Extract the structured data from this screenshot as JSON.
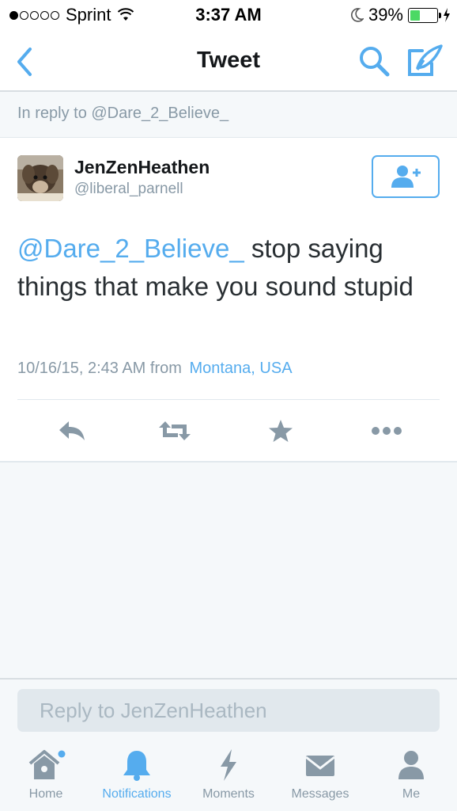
{
  "status_bar": {
    "carrier": "Sprint",
    "time": "3:37 AM",
    "battery": "39%",
    "battery_level": 0.39
  },
  "nav": {
    "title": "Tweet",
    "back_icon": "chevron-left-icon",
    "search_icon": "search-icon",
    "compose_icon": "compose-icon"
  },
  "reply_banner": "In reply to @Dare_2_Believe_",
  "tweet": {
    "display_name": "JenZenHeathen",
    "handle": "@liberal_parnell",
    "mention": "@Dare_2_Believe_",
    "text": " stop saying things that make you sound stupid",
    "timestamp": "10/16/15, 2:43 AM from",
    "location": "Montana, USA"
  },
  "reply": {
    "placeholder": "Reply to JenZenHeathen"
  },
  "tabs": [
    {
      "label": "Home",
      "icon": "home-icon",
      "active": false
    },
    {
      "label": "Notifications",
      "icon": "bell-icon",
      "active": true
    },
    {
      "label": "Moments",
      "icon": "lightning-icon",
      "active": false
    },
    {
      "label": "Messages",
      "icon": "envelope-icon",
      "active": false
    },
    {
      "label": "Me",
      "icon": "person-icon",
      "active": false
    }
  ],
  "colors": {
    "accent": "#55acee",
    "muted": "#8899a6",
    "text": "#292f33"
  }
}
